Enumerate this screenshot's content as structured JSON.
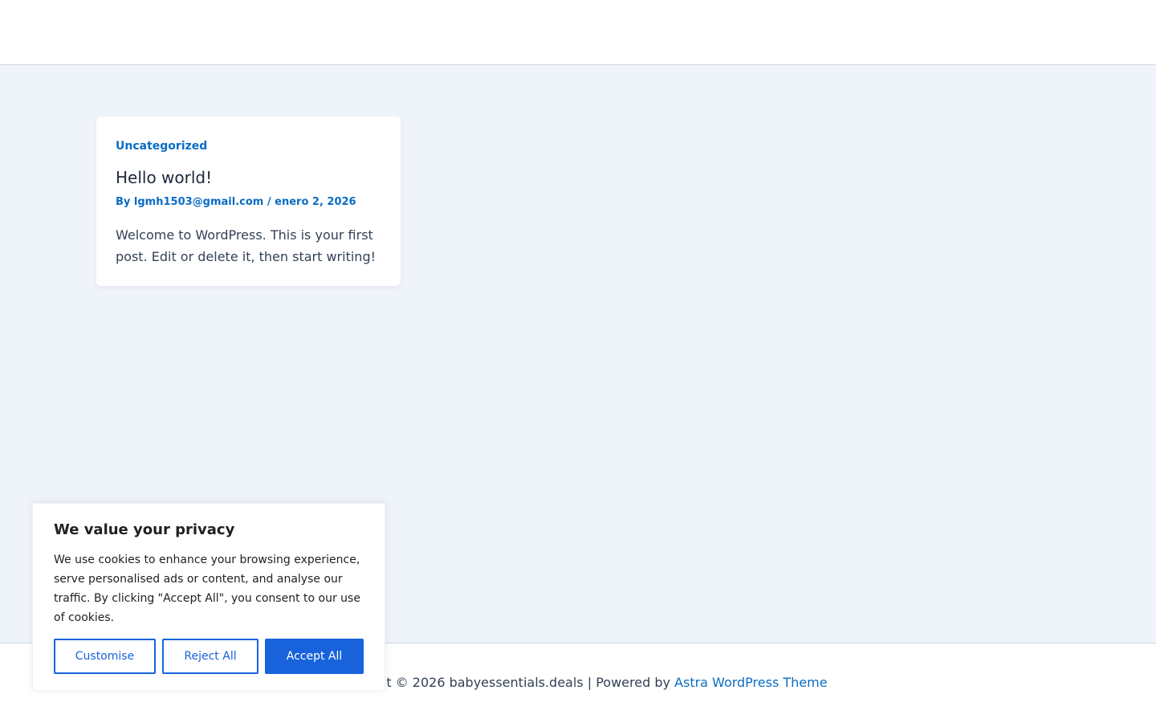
{
  "post": {
    "category": "Uncategorized",
    "title": "Hello world!",
    "meta_prefix": "By ",
    "author": "lgmh1503@gmail.com",
    "meta_separator": " / ",
    "date": "enero 2, 2026",
    "excerpt": "Welcome to WordPress. This is your first post. Edit or delete it, then start writing!"
  },
  "footer": {
    "copyright": "Copyright © 2026 babyessentials.deals | Powered by ",
    "theme_link": "Astra WordPress Theme"
  },
  "cookie_banner": {
    "title": "We value your privacy",
    "text": "We use cookies to enhance your browsing experience, serve personalised ads or content, and analyse our traffic. By clicking \"Accept All\", you consent to our use of cookies.",
    "customise_label": "Customise",
    "reject_label": "Reject All",
    "accept_label": "Accept All"
  },
  "colors": {
    "link": "#0a6cc4",
    "main_bg": "#eff4fa",
    "cookie_accent": "#1863dc"
  }
}
